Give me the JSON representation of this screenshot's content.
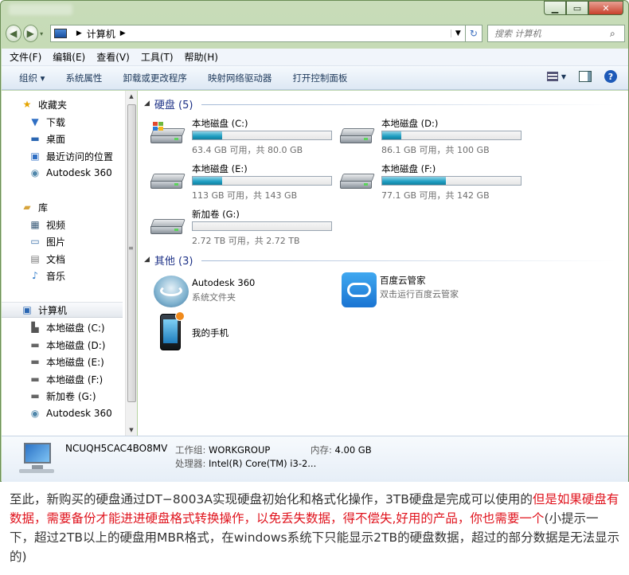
{
  "window": {
    "controls": {
      "min": "▁",
      "max": "▭",
      "close": "✕"
    }
  },
  "address": {
    "path_root_icon": "computer-icon",
    "path": "计算机",
    "search_placeholder": "搜索 计算机"
  },
  "menu": [
    "文件(F)",
    "编辑(E)",
    "查看(V)",
    "工具(T)",
    "帮助(H)"
  ],
  "commands": [
    "组织 ▾",
    "系统属性",
    "卸载或更改程序",
    "映射网络驱动器",
    "打开控制面板"
  ],
  "nav": {
    "favorites": {
      "label": "收藏夹",
      "items": [
        "下载",
        "桌面",
        "最近访问的位置",
        "Autodesk 360"
      ]
    },
    "libraries": {
      "label": "库",
      "items": [
        "视频",
        "图片",
        "文档",
        "音乐"
      ]
    },
    "computer": {
      "label": "计算机",
      "items": [
        "本地磁盘 (C:)",
        "本地磁盘 (D:)",
        "本地磁盘 (E:)",
        "本地磁盘 (F:)",
        "新加卷 (G:)",
        "Autodesk 360"
      ]
    }
  },
  "content": {
    "drives_header": "硬盘 (5)",
    "drives": [
      {
        "name": "本地磁盘 (C:)",
        "free": "63.4 GB 可用，共 80.0 GB",
        "used_fraction": 0.21
      },
      {
        "name": "本地磁盘 (D:)",
        "free": "86.1 GB 可用，共 100 GB",
        "used_fraction": 0.14
      },
      {
        "name": "本地磁盘 (E:)",
        "free": "113 GB 可用，共 143 GB",
        "used_fraction": 0.21
      },
      {
        "name": "本地磁盘 (F:)",
        "free": "77.1 GB 可用，共 142 GB",
        "used_fraction": 0.46
      },
      {
        "name": "新加卷 (G:)",
        "free": "2.72 TB 可用，共 2.72 TB",
        "used_fraction": 0.0
      }
    ],
    "other_header": "其他 (3)",
    "others": [
      {
        "name": "Autodesk 360",
        "sub": "系统文件夹"
      },
      {
        "name": "百度云管家",
        "sub": "双击运行百度云管家"
      },
      {
        "name": "我的手机",
        "sub": ""
      }
    ]
  },
  "details": {
    "pc_name": "NCUQH5CAC4BO8MV",
    "workgroup_label": "工作组:",
    "workgroup": "WORKGROUP",
    "memory_label": "内存:",
    "memory": "4.00 GB",
    "cpu_label": "处理器:",
    "cpu": "Intel(R) Core(TM) i3-2..."
  },
  "caption": {
    "part1": "至此，新购买的硬盘通过DT−8003A实现硬盘初始化和格式化操作，3TB硬盘是完成可以使用的",
    "part2_red": "但是如果硬盘有数据，需要备份才能进进硬盘格式转换操作，以免丢失数据，得不偿失,好用的产品，你也需要一个",
    "part3": "(小提示一下，超过2TB以上的硬盘用MBR格式，在windows系统下只能显示2TB的硬盘数据，超过的部分数据是无法显示的)"
  },
  "colors": {
    "bar_fill": "#1e9ec2",
    "group_header": "#1e3287",
    "caption_red": "#e0141e"
  }
}
